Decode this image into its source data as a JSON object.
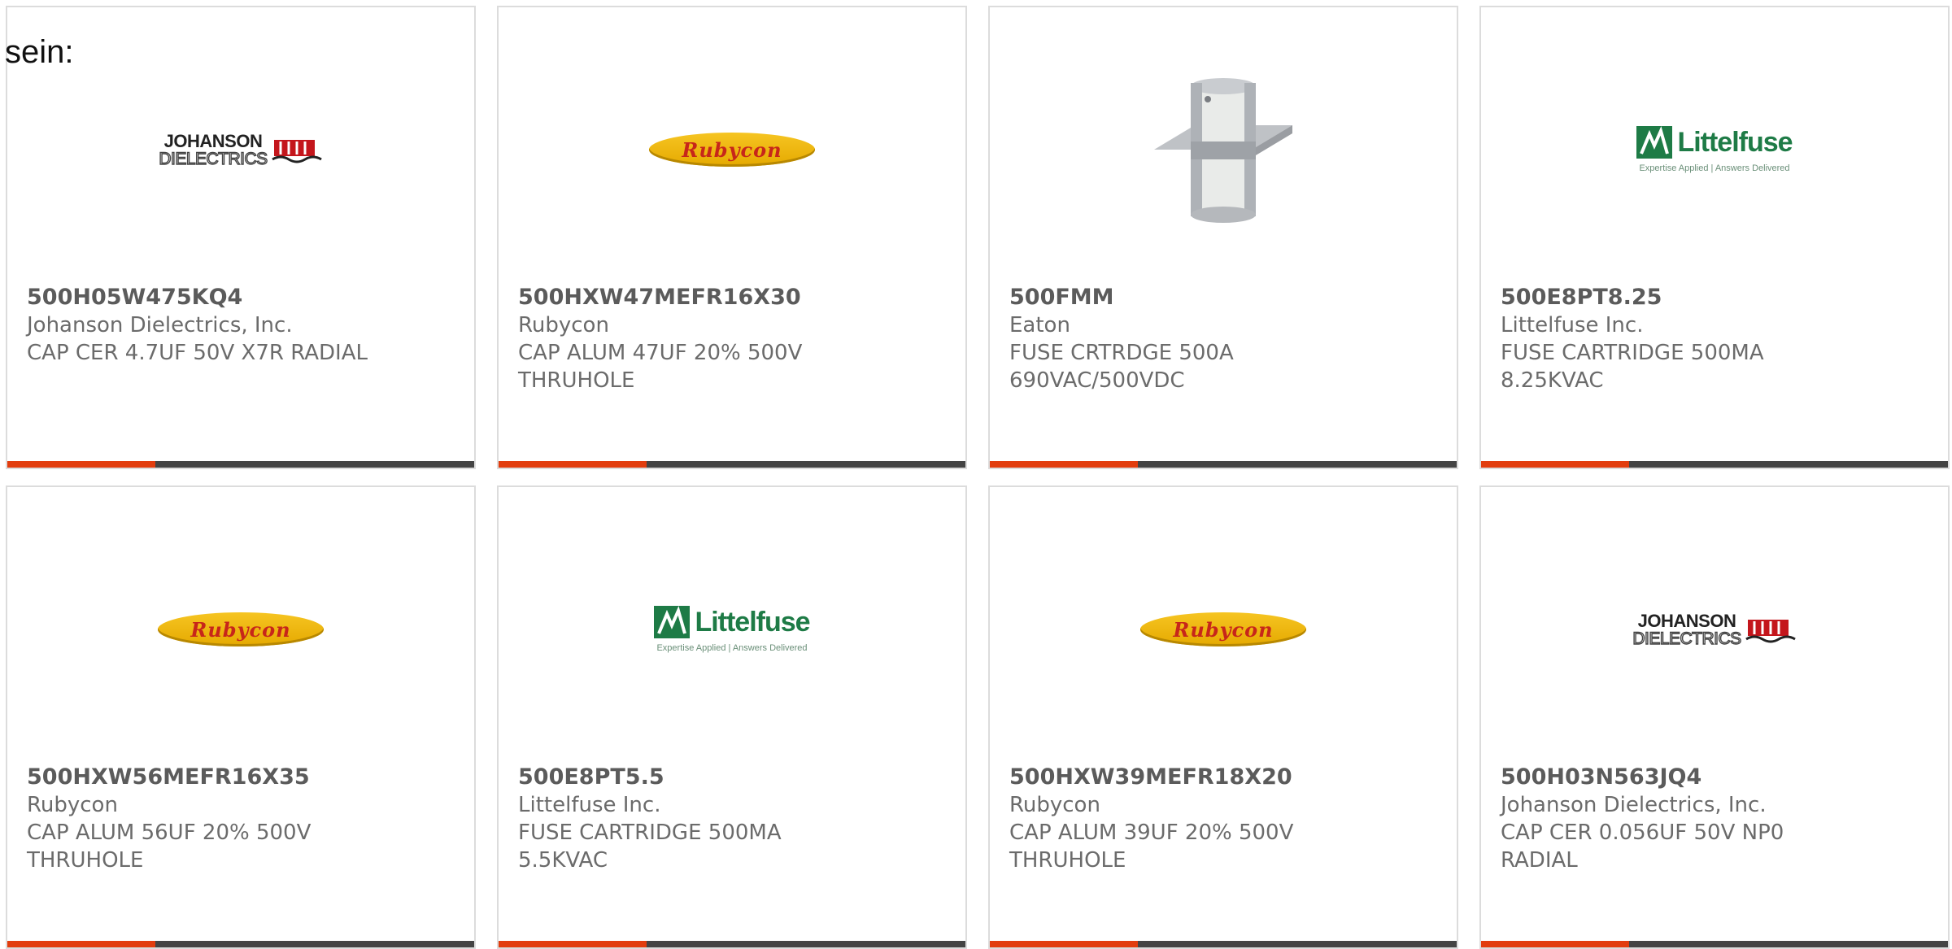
{
  "intro_text": "sein:",
  "colors": {
    "card_accent": "#e23d0e",
    "card_bar": "#444444",
    "card_border": "#dcdcdc"
  },
  "logos": {
    "johanson": {
      "line1": "JOHANSON",
      "line2": "DIELECTRICS",
      "icon": "johanson-dielectrics-logo"
    },
    "rubycon": {
      "text": "Rubycon",
      "icon": "rubycon-logo"
    },
    "littelfuse": {
      "name": "Littelfuse",
      "tagline": "Expertise Applied | Answers Delivered",
      "icon": "littelfuse-logo"
    },
    "eaton_fuse": {
      "icon": "cartridge-fuse-photo"
    }
  },
  "products": [
    {
      "part_number": "500H05W475KQ4",
      "manufacturer": "Johanson Dielectrics, Inc.",
      "description_lines": [
        "CAP CER 4.7UF 50V X7R RADIAL"
      ]
    },
    {
      "part_number": "500HXW47MEFR16X30",
      "manufacturer": "Rubycon",
      "description_lines": [
        "CAP ALUM 47UF 20% 500V",
        "THRUHOLE"
      ]
    },
    {
      "part_number": "500FMM",
      "manufacturer": "Eaton",
      "description_lines": [
        "FUSE CRTRDGE 500A",
        "690VAC/500VDC"
      ]
    },
    {
      "part_number": "500E8PT8.25",
      "manufacturer": "Littelfuse Inc.",
      "description_lines": [
        "FUSE CARTRIDGE 500MA",
        "8.25KVAC"
      ]
    },
    {
      "part_number": "500HXW56MEFR16X35",
      "manufacturer": "Rubycon",
      "description_lines": [
        "CAP ALUM 56UF 20% 500V",
        "THRUHOLE"
      ]
    },
    {
      "part_number": "500E8PT5.5",
      "manufacturer": "Littelfuse Inc.",
      "description_lines": [
        "FUSE CARTRIDGE 500MA",
        "5.5KVAC"
      ]
    },
    {
      "part_number": "500HXW39MEFR18X20",
      "manufacturer": "Rubycon",
      "description_lines": [
        "CAP ALUM 39UF 20% 500V",
        "THRUHOLE"
      ]
    },
    {
      "part_number": "500H03N563JQ4",
      "manufacturer": "Johanson Dielectrics, Inc.",
      "description_lines": [
        "CAP CER 0.056UF 50V NP0",
        "RADIAL"
      ]
    }
  ]
}
